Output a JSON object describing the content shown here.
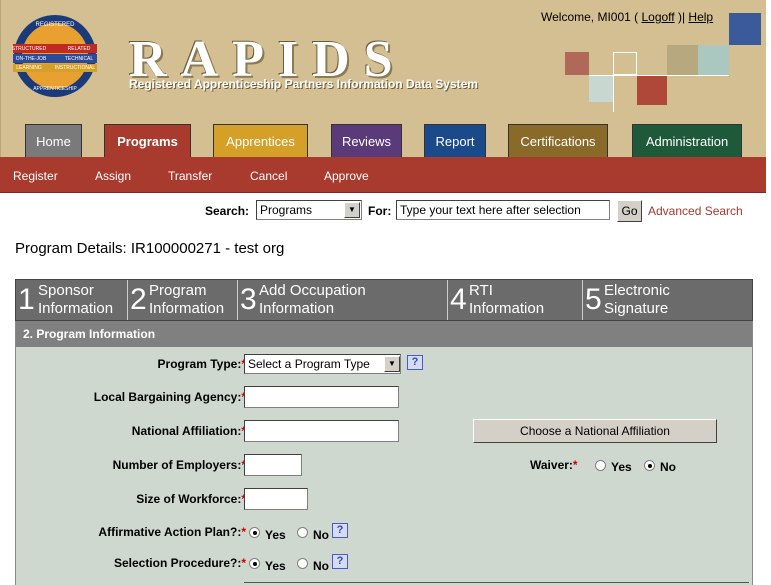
{
  "header": {
    "title": "RAPIDS",
    "subtitle": "Registered Apprenticeship Partners Information Data System",
    "welcome_prefix": "Welcome, MI001 ( ",
    "logoff": "Logoff",
    "sep": " )| ",
    "help": "Help"
  },
  "logo": {
    "t1": "REGISTERED",
    "t2": "STRUCTURED",
    "t3": "RELATED",
    "t4": "ON-THE-JOB",
    "t5": "TECHNICAL",
    "t6": "LEARNING",
    "t7": "INSTRUCTIONAL",
    "t8": "APPRENTICESHIP"
  },
  "tabs": [
    {
      "label": "Home",
      "color": "#7a7a7a"
    },
    {
      "label": "Programs",
      "color": "#a83a2e"
    },
    {
      "label": "Apprentices",
      "color": "#d4a028"
    },
    {
      "label": "Reviews",
      "color": "#5a3a78"
    },
    {
      "label": "Report",
      "color": "#1a4a8a"
    },
    {
      "label": "Certifications",
      "color": "#8a6a28"
    },
    {
      "label": "Administration",
      "color": "#1e5a3a"
    }
  ],
  "subnav": [
    "Register",
    "Assign",
    "Transfer",
    "Cancel",
    "Approve"
  ],
  "search": {
    "label": "Search:",
    "selected": "Programs",
    "for_label": "For:",
    "placeholder": "Type your text here after selection",
    "go": "Go",
    "advanced": "Advanced Search"
  },
  "page_title": "Program Details: IR100000271 - test org",
  "steps": [
    {
      "num": "1",
      "line1": "Sponsor",
      "line2": "Information"
    },
    {
      "num": "2",
      "line1": "Program",
      "line2": "Information"
    },
    {
      "num": "3",
      "line1": "Add Occupation",
      "line2": "Information"
    },
    {
      "num": "4",
      "line1": "RTI",
      "line2": "Information"
    },
    {
      "num": "5",
      "line1": "Electronic",
      "line2": "Signature"
    }
  ],
  "panel": {
    "heading": "2.   Program Information"
  },
  "form": {
    "program_type": {
      "label": "Program Type:",
      "value": "Select a Program Type"
    },
    "local_bargaining": {
      "label": "Local Bargaining Agency:",
      "value": ""
    },
    "national_affiliation": {
      "label": "National Affiliation:",
      "value": "",
      "button": "Choose a National Affiliation"
    },
    "num_employers": {
      "label": "Number of Employers:",
      "value": ""
    },
    "waiver": {
      "label": "Waiver:",
      "yes": "Yes",
      "no": "No",
      "selected": "No"
    },
    "workforce": {
      "label": "Size of Workforce:",
      "value": ""
    },
    "affirmative": {
      "label": "Affirmative Action Plan?:",
      "yes": "Yes",
      "no": "No",
      "selected": "Yes"
    },
    "selection": {
      "label": "Selection Procedure?:",
      "yes": "Yes",
      "no": "No",
      "selected": "Yes"
    },
    "required_mark": "*",
    "help_mark": "?"
  }
}
